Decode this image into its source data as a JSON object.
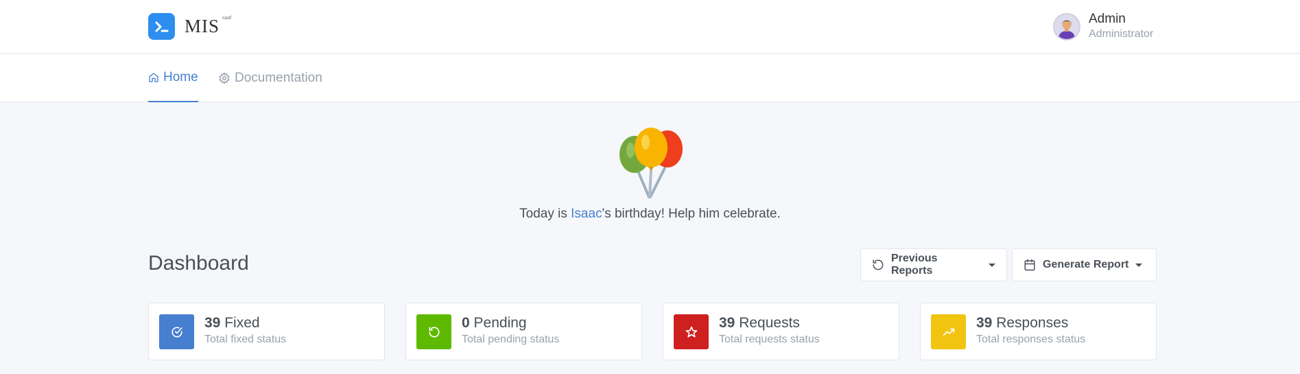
{
  "brand": {
    "name": "MIS",
    "sup": "saaf"
  },
  "user": {
    "name": "Admin",
    "role": "Administrator"
  },
  "nav": {
    "home": "Home",
    "docs": "Documentation"
  },
  "celebration": {
    "prefix": "Today is ",
    "name": "Isaac",
    "suffix": "'s birthday! Help him celebrate."
  },
  "dashboard": {
    "title": "Dashboard",
    "previous_reports": "Previous Reports",
    "generate_report": "Generate Report"
  },
  "cards": [
    {
      "count": "39",
      "label": "Fixed",
      "subtitle": "Total fixed status",
      "color": "#467fcf",
      "icon": "check-circle-icon"
    },
    {
      "count": "0",
      "label": "Pending",
      "subtitle": "Total pending status",
      "color": "#5eba00",
      "icon": "refresh-icon"
    },
    {
      "count": "39",
      "label": "Requests",
      "subtitle": "Total requests status",
      "color": "#cd201f",
      "icon": "star-icon"
    },
    {
      "count": "39",
      "label": "Responses",
      "subtitle": "Total responses status",
      "color": "#f1c40f",
      "icon": "trending-up-icon"
    }
  ],
  "colors": {
    "accent": "#467fcf",
    "logo": "#2d8ef0"
  }
}
